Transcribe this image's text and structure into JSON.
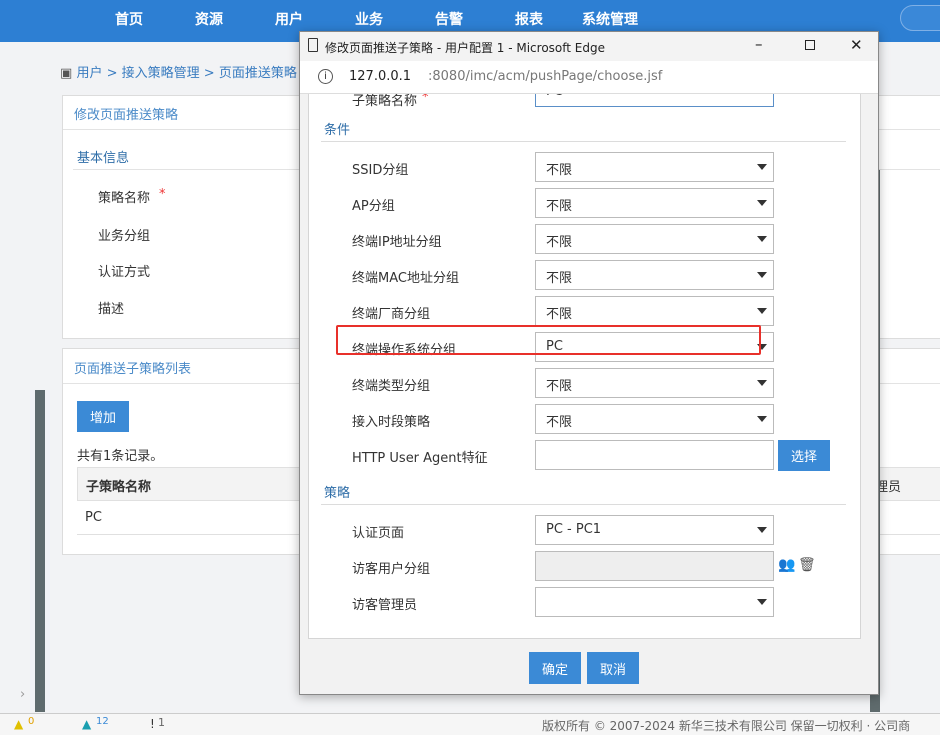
{
  "nav": {
    "items": [
      "首页",
      "资源",
      "用户",
      "业务",
      "告警",
      "报表",
      "系统管理"
    ]
  },
  "breadcrumb": [
    "用户",
    "接入策略管理",
    "页面推送策略"
  ],
  "main": {
    "panel_title": "修改页面推送策略",
    "basic_info": "基本信息",
    "fields": [
      "策略名称",
      "业务分组",
      "认证方式",
      "描述"
    ],
    "required_mark": "*",
    "list_title": "页面推送子策略列表",
    "add_label": "增加",
    "record_count": "共有1条记录。",
    "table": {
      "headers": [
        "子策略名称",
        "理员"
      ],
      "rows": [
        [
          "PC"
        ]
      ]
    }
  },
  "footer": {
    "alarm_counts": [
      "0",
      "12",
      "1"
    ],
    "copyright": "版权所有 © 2007-2024 新华三技术有限公司   保留一切权利 · 公司商"
  },
  "popup": {
    "title": "修改页面推送子策略 - 用户配置 1 - Microsoft Edge",
    "url_host": "127.0.0.1",
    "url_rest": ":8080/imc/acm/pushPage/choose.jsf",
    "subpolicy_label": "子策略名称",
    "subpolicy_value": "PC",
    "section_conditions": "条件",
    "conditions": [
      {
        "label": "SSID分组",
        "value": "不限"
      },
      {
        "label": "AP分组",
        "value": "不限"
      },
      {
        "label": "终端IP地址分组",
        "value": "不限"
      },
      {
        "label": "终端MAC地址分组",
        "value": "不限"
      },
      {
        "label": "终端厂商分组",
        "value": "不限"
      },
      {
        "label": "终端操作系统分组",
        "value": "PC"
      },
      {
        "label": "终端类型分组",
        "value": "不限"
      },
      {
        "label": "接入时段策略",
        "value": "不限"
      }
    ],
    "http_ua_label": "HTTP User Agent特征",
    "http_ua_value": "",
    "choose_label": "选择",
    "section_policy": "策略",
    "auth_page_label": "认证页面",
    "auth_page_value": "PC - PC1",
    "guest_group_label": "访客用户分组",
    "guest_group_value": "",
    "guest_admin_label": "访客管理员",
    "guest_admin_value": "",
    "ok_label": "确定",
    "cancel_label": "取消",
    "highlight_color": "#e8302a"
  }
}
